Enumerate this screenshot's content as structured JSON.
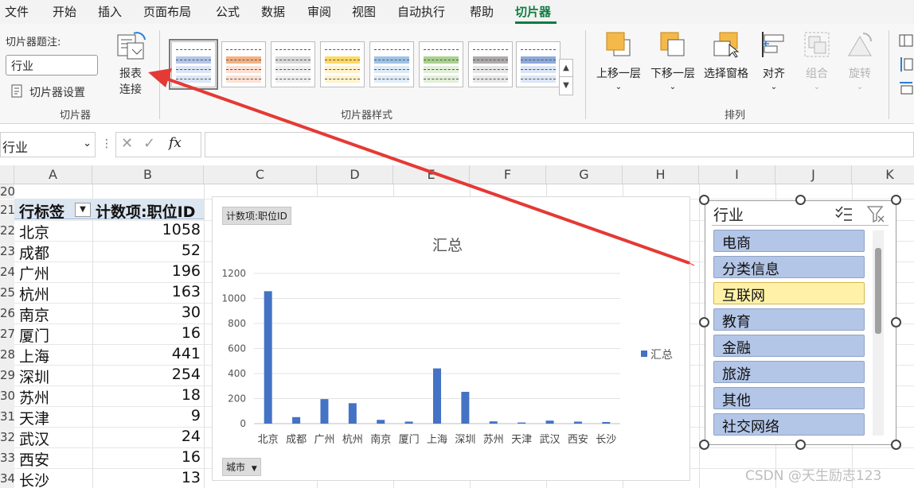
{
  "menu": {
    "items": [
      "文件",
      "开始",
      "插入",
      "页面布局",
      "公式",
      "数据",
      "审阅",
      "视图",
      "自动执行",
      "帮助",
      "切片器"
    ],
    "active": "切片器"
  },
  "ribbon": {
    "slicer_group": {
      "caption_label": "切片器题注:",
      "caption_value": "行业",
      "settings_label": "切片器设置",
      "report_conn_label_1": "报表",
      "report_conn_label_2": "连接",
      "group_label": "切片器"
    },
    "styles_group": {
      "group_label": "切片器样式"
    },
    "arrange_group": {
      "bring_forward": "上移一层",
      "send_backward": "下移一层",
      "selection_pane": "选择窗格",
      "align": "对齐",
      "group": "组合",
      "rotate": "旋转",
      "group_label": "排列"
    }
  },
  "formula_bar": {
    "name_box": "行业",
    "fx": "fx",
    "formula": ""
  },
  "columns": [
    "A",
    "B",
    "C",
    "D",
    "E",
    "F",
    "G",
    "H",
    "I",
    "J",
    "K"
  ],
  "rows": [
    "20",
    "21",
    "22",
    "23",
    "24",
    "25",
    "26",
    "27",
    "28",
    "29",
    "30",
    "31",
    "32",
    "33",
    "34"
  ],
  "pivot": {
    "header_label": "行标签",
    "header_value": "计数项:职位ID",
    "data": [
      {
        "city": "北京",
        "count": "1058"
      },
      {
        "city": "成都",
        "count": "52"
      },
      {
        "city": "广州",
        "count": "196"
      },
      {
        "city": "杭州",
        "count": "163"
      },
      {
        "city": "南京",
        "count": "30"
      },
      {
        "city": "厦门",
        "count": "16"
      },
      {
        "city": "上海",
        "count": "441"
      },
      {
        "city": "深圳",
        "count": "254"
      },
      {
        "city": "苏州",
        "count": "18"
      },
      {
        "city": "天津",
        "count": "9"
      },
      {
        "city": "武汉",
        "count": "24"
      },
      {
        "city": "西安",
        "count": "16"
      },
      {
        "city": "长沙",
        "count": "13"
      }
    ]
  },
  "chart_field_value": "计数项:职位ID",
  "chart_field_axis": "城市",
  "chart_data": {
    "type": "bar",
    "title": "汇总",
    "categories": [
      "北京",
      "成都",
      "广州",
      "杭州",
      "南京",
      "厦门",
      "上海",
      "深圳",
      "苏州",
      "天津",
      "武汉",
      "西安",
      "长沙"
    ],
    "series": [
      {
        "name": "汇总",
        "values": [
          1058,
          52,
          196,
          163,
          30,
          16,
          441,
          254,
          18,
          9,
          24,
          16,
          13
        ]
      }
    ],
    "yticks": [
      "0",
      "200",
      "400",
      "600",
      "800",
      "1000",
      "1200"
    ],
    "ylim": [
      0,
      1200
    ],
    "legend_position": "right",
    "color": "#4472c4"
  },
  "slicer": {
    "title": "行业",
    "items": [
      "电商",
      "分类信息",
      "互联网",
      "教育",
      "金融",
      "旅游",
      "其他",
      "社交网络"
    ],
    "selected": "互联网"
  },
  "watermark": "CSDN @天生励志123",
  "colors": {
    "accent": "#107c41",
    "bar": "#4472c4",
    "annotation_arrow": "#e53935",
    "slicer_item": "#b4c6e7",
    "slicer_selected": "#fff2a8"
  }
}
